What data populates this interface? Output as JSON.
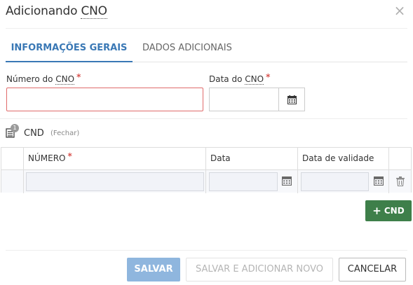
{
  "dialog": {
    "title_prefix": "Adicionando ",
    "title_abbr": "CNO",
    "close_glyph": "×"
  },
  "tabs": [
    {
      "label": "INFORMAÇÕES GERAIS",
      "active": true
    },
    {
      "label": "DADOS ADICIONAIS",
      "active": false
    }
  ],
  "form": {
    "numero_cno": {
      "label_prefix": "Número do ",
      "label_abbr": "CNO",
      "required_mark": "*",
      "value": ""
    },
    "data_cno": {
      "label_prefix": "Data do ",
      "label_abbr": "CNO",
      "required_mark": "*",
      "value": ""
    }
  },
  "cnd_section": {
    "badge_count": "1",
    "title": "CND",
    "toggle_label": "(Fechar)",
    "columns": [
      {
        "label": "NÚMERO",
        "required_mark": "*"
      },
      {
        "label": "Data"
      },
      {
        "label": "Data de validade"
      }
    ],
    "rows": [
      {
        "numero": "",
        "data": "",
        "data_validade": ""
      }
    ],
    "add_button_label": "CND",
    "add_button_glyph": "+"
  },
  "footer": {
    "save_label": "SALVAR",
    "save_new_label": "SALVAR E ADICIONAR NOVO",
    "cancel_label": "CANCELAR"
  },
  "colors": {
    "accent": "#3a78b5",
    "required": "#d9534f",
    "add_button": "#3e7f4a",
    "save_button": "#8fb6de",
    "error_border": "#e06b6b"
  }
}
